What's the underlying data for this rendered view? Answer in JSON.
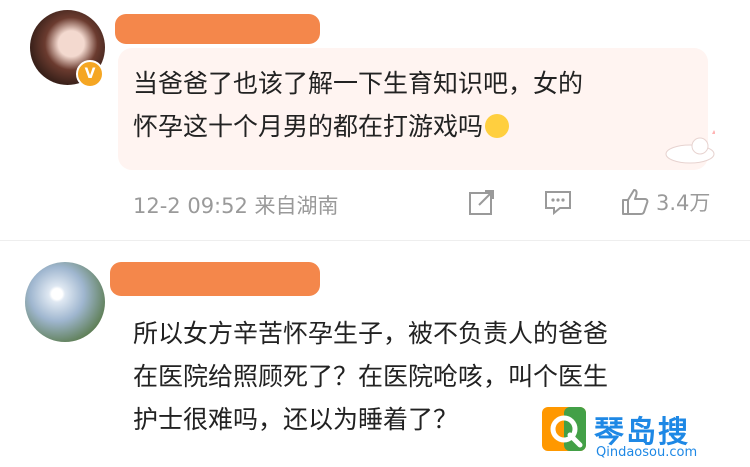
{
  "comments": [
    {
      "text_lines": [
        "当爸爸了也该了解一下生育知识吧，女的",
        "怀孕这十个月男的都在打游戏吗"
      ],
      "timestamp": "12-2 09:52",
      "location": "来自湖南",
      "like_count": "3.4万",
      "verified_badge": "V"
    },
    {
      "text_lines": [
        "所以女方辛苦怀孕生子，被不负责人的爸爸",
        "在医院给照顾死了？在医院呛咳，叫个医生",
        "护士很难吗，还以为睡着了？"
      ]
    }
  ],
  "watermark": {
    "title": "琴岛搜",
    "url": "Qindaosou.com"
  },
  "colors": {
    "redaction": "#f4874b",
    "bubble": "#fff4f1",
    "meta": "#9a9a9a",
    "watermark": "#1e88e5"
  },
  "icons": [
    "share-icon",
    "comment-icon",
    "like-icon",
    "emoji-icon"
  ]
}
